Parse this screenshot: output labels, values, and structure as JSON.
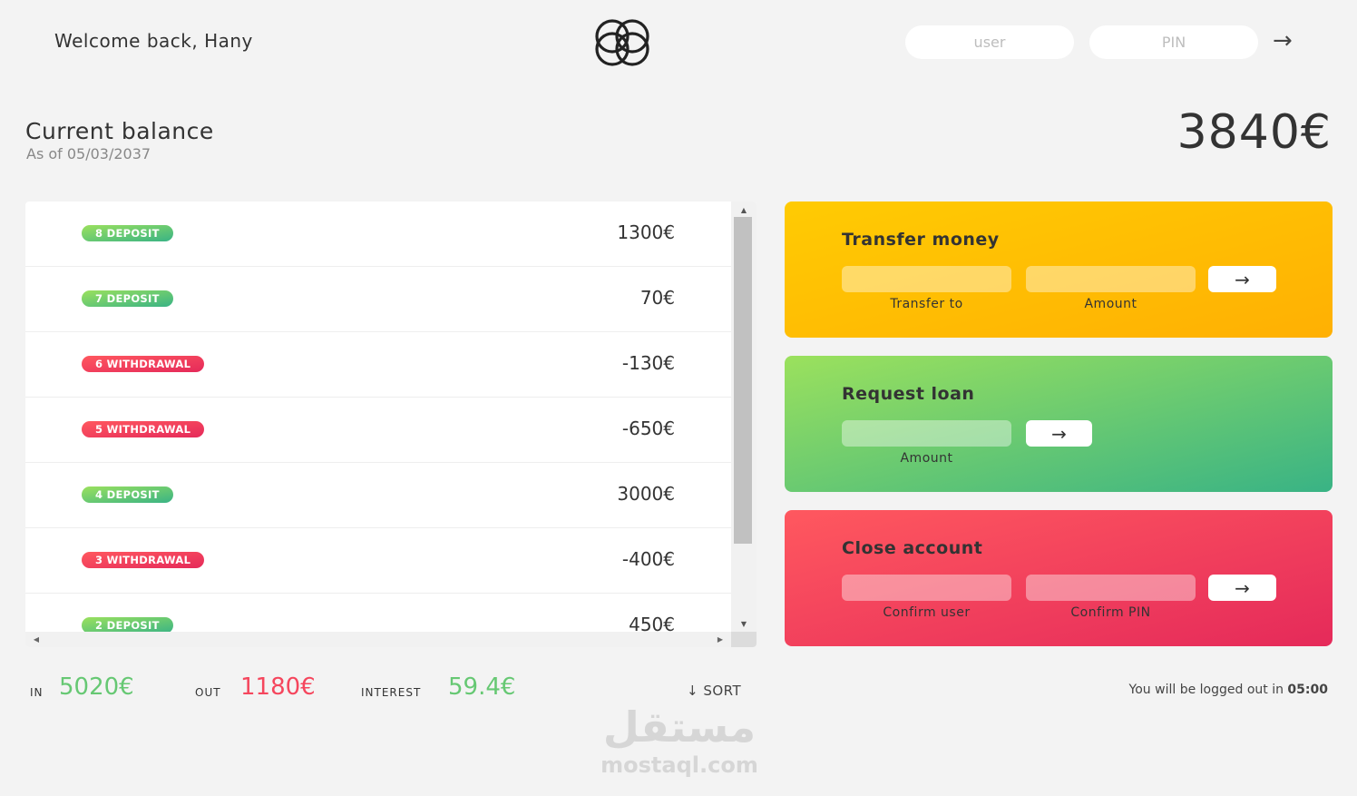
{
  "nav": {
    "welcome": "Welcome back, Hany",
    "user_placeholder": "user",
    "pin_placeholder": "PIN",
    "login_arrow": "→"
  },
  "balance": {
    "label": "Current balance",
    "date": "As of 05/03/2037",
    "value": "3840€"
  },
  "movements": [
    {
      "type_label": "8 DEPOSIT",
      "kind": "deposit",
      "value": "1300€"
    },
    {
      "type_label": "7 DEPOSIT",
      "kind": "deposit",
      "value": "70€"
    },
    {
      "type_label": "6 WITHDRAWAL",
      "kind": "withdrawal",
      "value": "-130€"
    },
    {
      "type_label": "5 WITHDRAWAL",
      "kind": "withdrawal",
      "value": "-650€"
    },
    {
      "type_label": "4 DEPOSIT",
      "kind": "deposit",
      "value": "3000€"
    },
    {
      "type_label": "3 WITHDRAWAL",
      "kind": "withdrawal",
      "value": "-400€"
    },
    {
      "type_label": "2 DEPOSIT",
      "kind": "deposit",
      "value": "450€"
    }
  ],
  "colors": {
    "deposit": "#66c873",
    "withdrawal": "#e52a5a"
  },
  "summary": {
    "in_label": "IN",
    "in_value": "5020€",
    "out_label": "OUT",
    "out_value": "1180€",
    "interest_label": "INTEREST",
    "interest_value": "59.4€",
    "sort_label": "↓ SORT"
  },
  "operations": {
    "transfer": {
      "title": "Transfer money",
      "to_label": "Transfer to",
      "amount_label": "Amount",
      "button": "→"
    },
    "loan": {
      "title": "Request loan",
      "amount_label": "Amount",
      "button": "→"
    },
    "close": {
      "title": "Close account",
      "user_label": "Confirm user",
      "pin_label": "Confirm PIN",
      "button": "→"
    }
  },
  "logout": {
    "text": "You will be logged out in ",
    "timer": "05:00"
  },
  "watermark": {
    "arabic": "مستقل",
    "latin": "mostaql.com"
  }
}
